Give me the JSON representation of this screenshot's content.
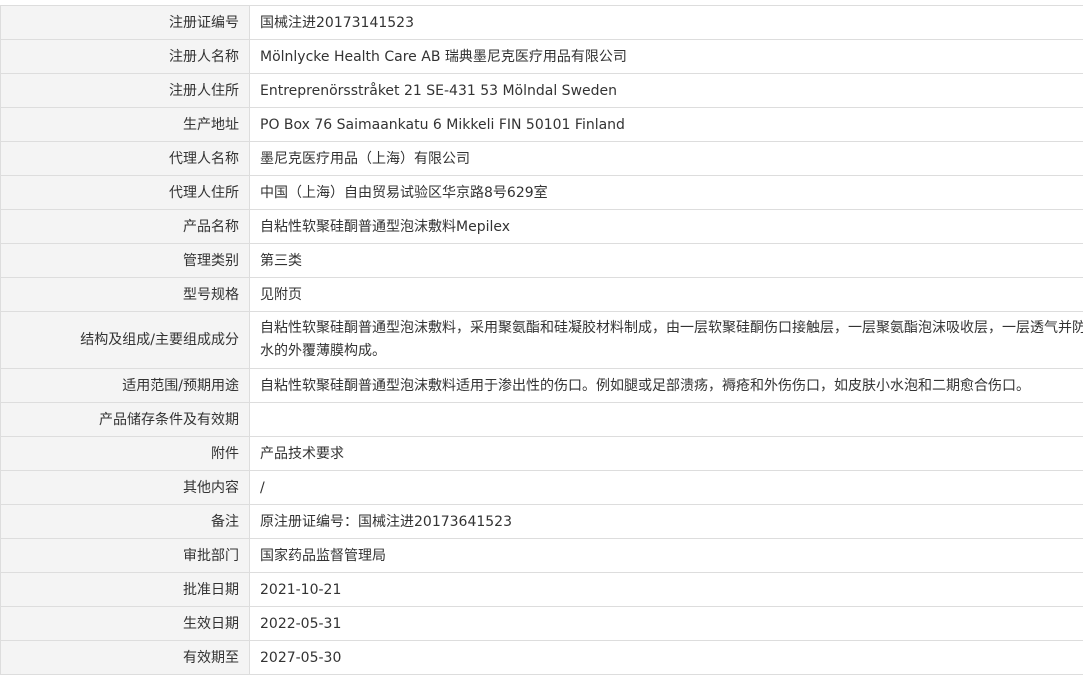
{
  "rows": [
    {
      "label": "注册证编号",
      "value": "国械注进20173141523"
    },
    {
      "label": "注册人名称",
      "value": "Mölnlycke Health Care AB 瑞典墨尼克医疗用品有限公司"
    },
    {
      "label": "注册人住所",
      "value": "Entreprenörsstråket 21 SE-431 53 Mölndal Sweden"
    },
    {
      "label": "生产地址",
      "value": "PO Box 76 Saimaankatu 6 Mikkeli FIN 50101 Finland"
    },
    {
      "label": "代理人名称",
      "value": "墨尼克医疗用品（上海）有限公司"
    },
    {
      "label": "代理人住所",
      "value": "中国（上海）自由贸易试验区华京路8号629室"
    },
    {
      "label": "产品名称",
      "value": "自粘性软聚硅酮普通型泡沫敷料Mepilex"
    },
    {
      "label": "管理类别",
      "value": "第三类"
    },
    {
      "label": "型号规格",
      "value": "见附页"
    },
    {
      "label": "结构及组成/主要组成成分",
      "value_line1": "自粘性软聚硅酮普通型泡沫敷料，采用聚氨酯和硅凝胶材料制成，由一层软聚硅酮伤口接触层，一层聚氨酯泡沫吸收层，一层透气并防",
      "value_line2": "水的外覆薄膜构成。"
    },
    {
      "label": "适用范围/预期用途",
      "value": "自粘性软聚硅酮普通型泡沫敷料适用于渗出性的伤口。例如腿或足部溃疡，褥疮和外伤伤口，如皮肤小水泡和二期愈合伤口。"
    },
    {
      "label": "产品储存条件及有效期",
      "value": ""
    },
    {
      "label": "附件",
      "value": "产品技术要求"
    },
    {
      "label": "其他内容",
      "value": "/"
    },
    {
      "label": "备注",
      "value": "原注册证编号：国械注进20173641523"
    },
    {
      "label": "审批部门",
      "value": "国家药品监督管理局"
    },
    {
      "label": "批准日期",
      "value": "2021-10-21"
    },
    {
      "label": "生效日期",
      "value": "2022-05-31"
    },
    {
      "label": "有效期至",
      "value": "2027-05-30"
    }
  ]
}
